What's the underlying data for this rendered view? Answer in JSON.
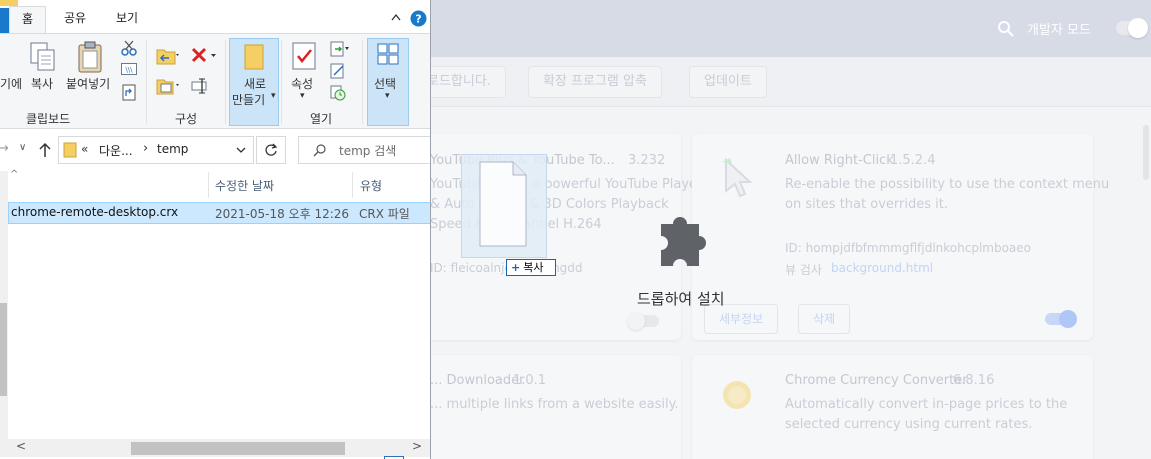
{
  "explorer": {
    "ribbon_tabs": [
      "홈",
      "공유",
      "보기"
    ],
    "clipboard": {
      "pin_label": "기에",
      "copy_label": "복사",
      "paste_label": "붙여넣기",
      "group_label": "클립보드"
    },
    "organize": {
      "group_label": "구성"
    },
    "new": {
      "new_folder_label_1": "새로",
      "new_folder_label_2": "만들기"
    },
    "open": {
      "properties_label": "속성",
      "group_label": "열기"
    },
    "select": {
      "select_label": "선택"
    },
    "address": {
      "crumb_prefix": "«",
      "crumb_1": "다운...",
      "crumb_sep": "›",
      "crumb_2": "temp"
    },
    "search": {
      "placeholder": "temp 검색"
    },
    "columns": {
      "modified": "수정한 날짜",
      "type": "유형"
    },
    "files": [
      {
        "name": "chrome-remote-desktop.crx",
        "modified": "2021-05-18 오후 12:26",
        "type": "CRX 파일"
      }
    ]
  },
  "chrome": {
    "header": {
      "dev_mode_label": "개발자 모드"
    },
    "toolbar": {
      "partial_label": "로드합니다.",
      "pack_label": "확장 프로그램 압축",
      "update_label": "업데이트"
    },
    "cards": [
      {
        "title": "YouTube Plus & YouTube To...",
        "version": "3.232",
        "desc_1": "YouTube Plus is a powerful YouTube Player",
        "desc_2": "& Auto Quality & 3D Colors Playback",
        "desc_3": "Speed & ... Channel H.264",
        "id": "ID: fleicoalnjcjpbhiamgdd"
      },
      {
        "title": "Allow Right-Click",
        "version": "1.5.2.4",
        "desc_1": "Re-enable the possibility to use the context menu",
        "desc_2": "on sites that overrides it.",
        "id": "ID: hompjdfbfmmmgflfjdlnkohcplmboaeo",
        "views_label": "뷰 검사",
        "view_link": "background.html",
        "details_label": "세부정보",
        "remove_label": "삭제"
      },
      {
        "title": "... Downloader",
        "version": "1.0.1",
        "desc_1": "... multiple links from a website easily."
      },
      {
        "title": "Chrome Currency Converter",
        "version": "6.8.16",
        "desc_1": "Automatically convert in-page prices to the",
        "desc_2": "selected currency using current rates."
      }
    ],
    "drop_overlay": {
      "label": "드롭하여 설치"
    }
  },
  "drag": {
    "copy_badge": "복사"
  }
}
